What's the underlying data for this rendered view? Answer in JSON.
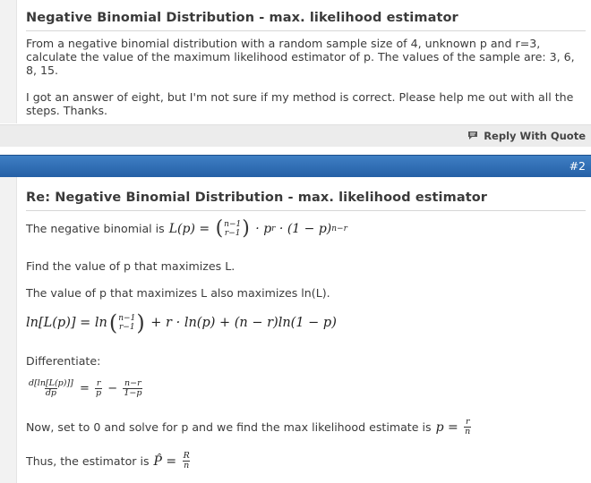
{
  "post1": {
    "title": "Negative Binomial Distribution - max. likelihood estimator",
    "paragraph1": "From a negative binomial distribution with a random sample size of 4, unknown p and r=3, calculate the value of the maximum likelihood estimator of p. The values of the sample are: 3, 6, 8, 15.",
    "paragraph2": "I got an answer of eight, but I'm not sure if my method is correct. Please help me out with all the steps. Thanks."
  },
  "footer": {
    "reply_label": "Reply With Quote"
  },
  "post2": {
    "number": "#2",
    "title": "Re: Negative Binomial Distribution - max. likelihood estimator",
    "line1_text": "The negative binomial is",
    "line2_text": "Find the value of p that maximizes L.",
    "line3_text": "The value of p that maximizes L also maximizes ln(L).",
    "line5_text": "Differentiate:",
    "line7_text": "Now, set to 0 and solve for p and we find the max likelihood estimate is",
    "line8_text": "Thus, the estimator is"
  },
  "colors": {
    "header_blue": "#2f6db5",
    "footer_gray": "#ececec"
  },
  "icons": {
    "reply": "quote-bubble-icon"
  }
}
